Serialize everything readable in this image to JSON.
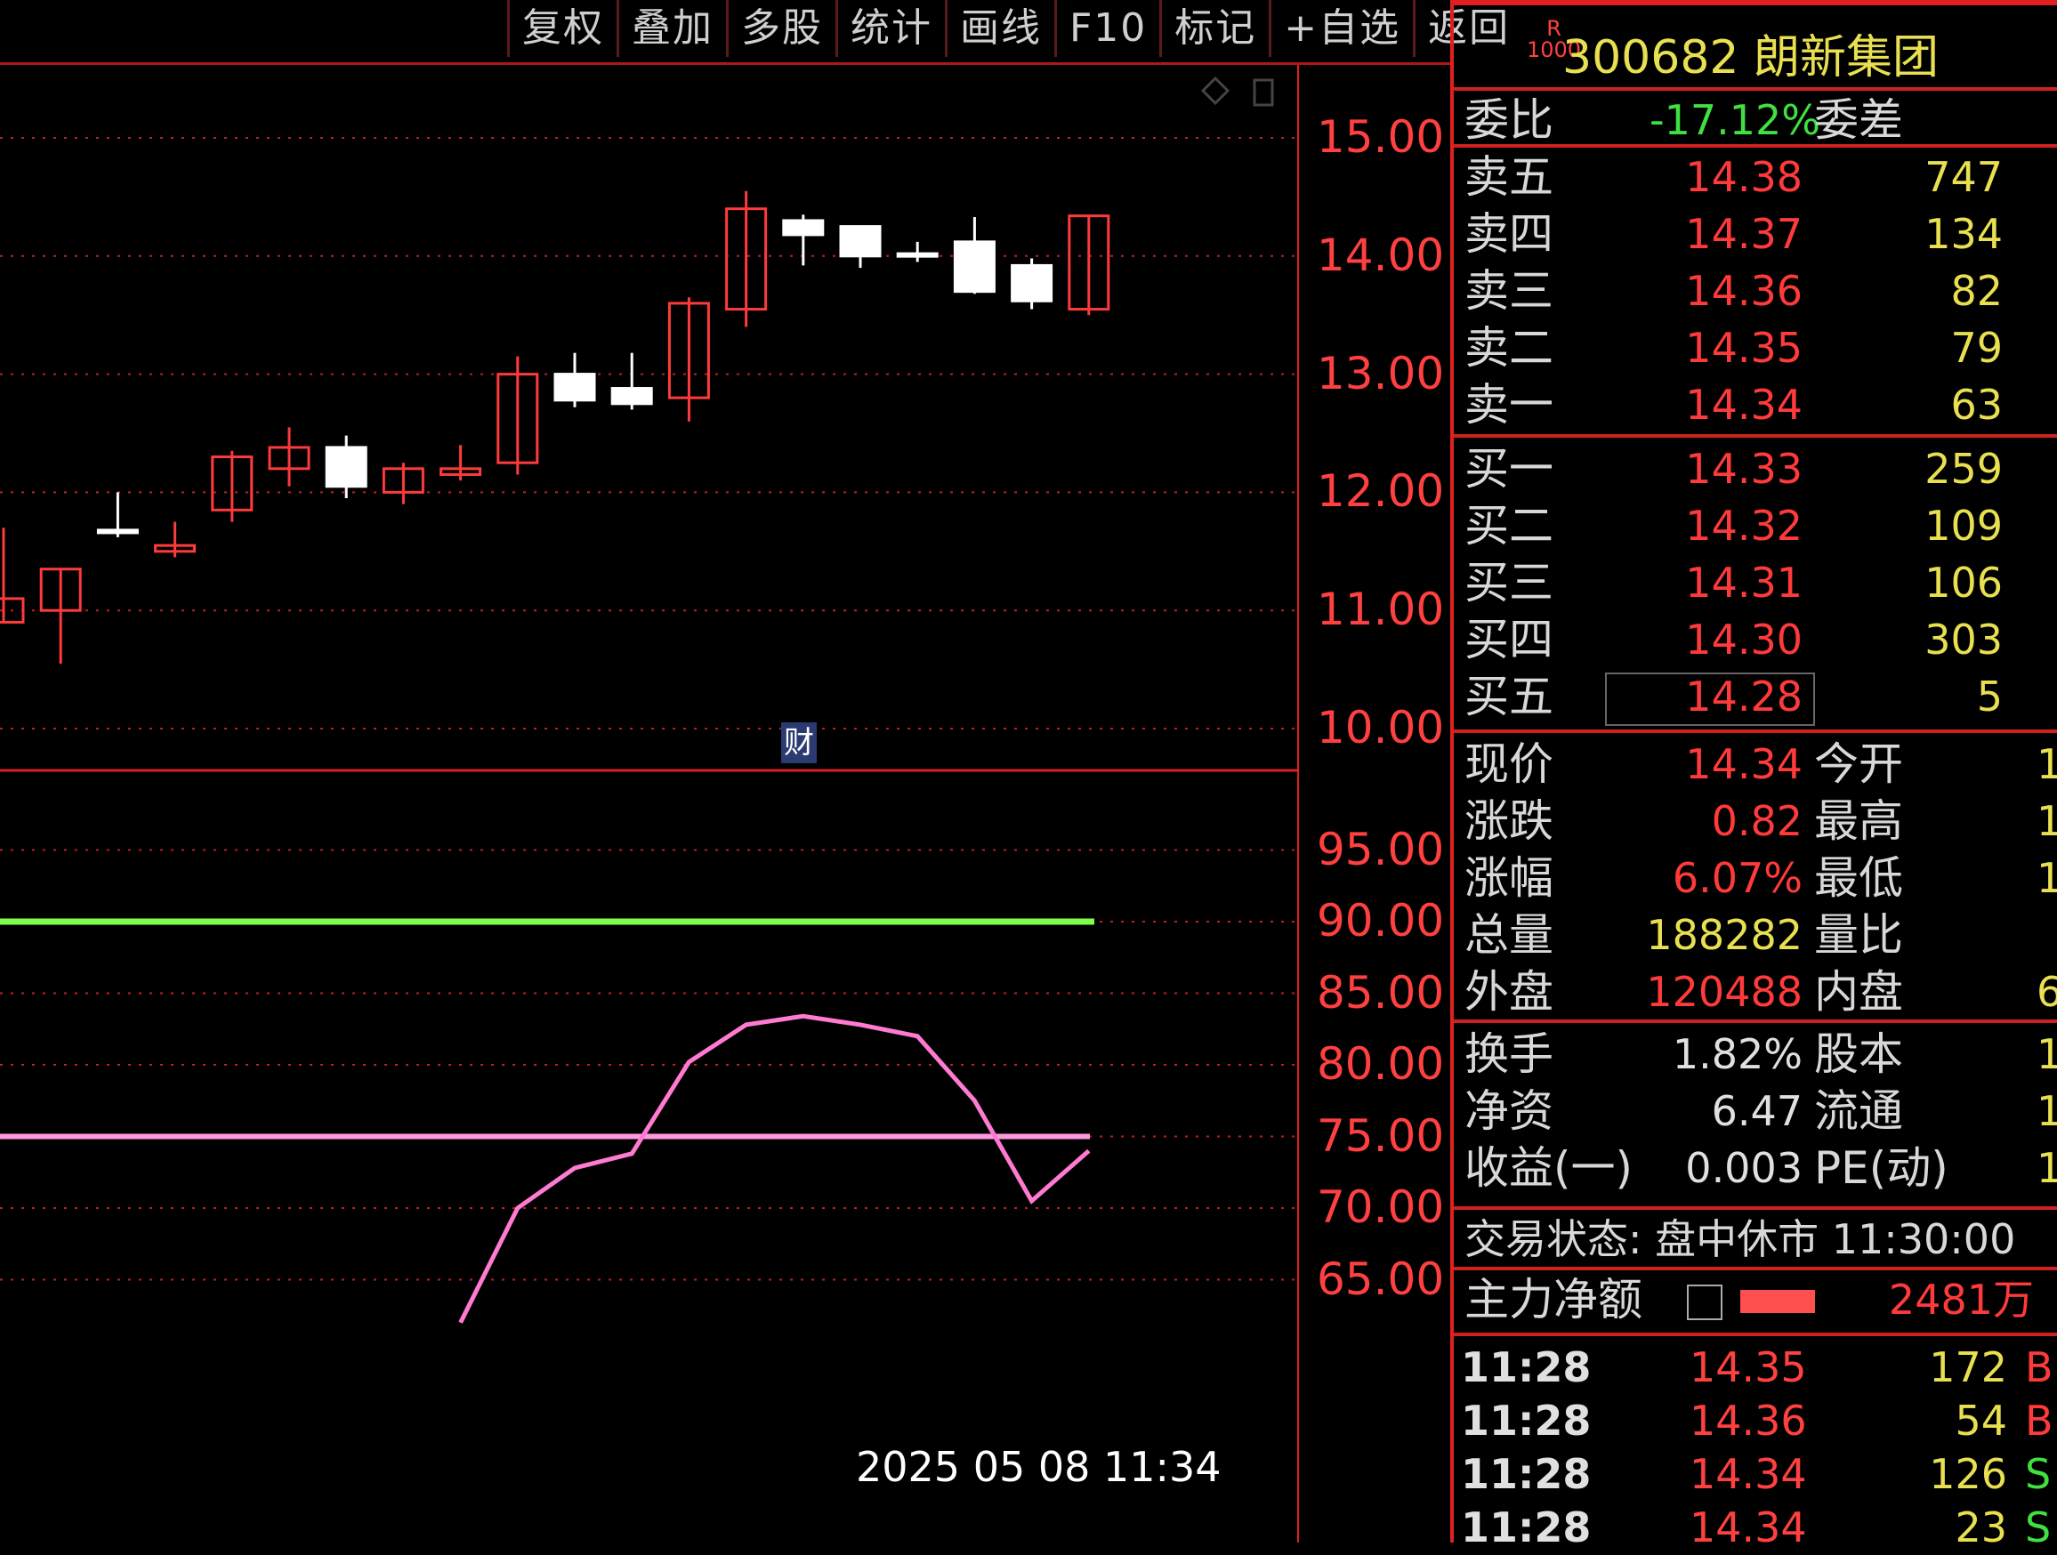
{
  "toolbar": {
    "buttons": [
      "复权",
      "叠加",
      "多股",
      "统计",
      "画线",
      "F10",
      "标记",
      "+自选",
      "返回"
    ]
  },
  "stock": {
    "r_badge": "R",
    "r_badge_num": "1000",
    "code_name": "300682 朗新集团"
  },
  "order_book": {
    "weibi_label": "委比",
    "weibi_value": "-17.12%",
    "weicha_label": "委差",
    "asks": [
      {
        "label": "卖五",
        "price": "14.38",
        "vol": "747"
      },
      {
        "label": "卖四",
        "price": "14.37",
        "vol": "134"
      },
      {
        "label": "卖三",
        "price": "14.36",
        "vol": "82"
      },
      {
        "label": "卖二",
        "price": "14.35",
        "vol": "79"
      },
      {
        "label": "卖一",
        "price": "14.34",
        "vol": "63"
      }
    ],
    "bids": [
      {
        "label": "买一",
        "price": "14.33",
        "vol": "259"
      },
      {
        "label": "买二",
        "price": "14.32",
        "vol": "109"
      },
      {
        "label": "买三",
        "price": "14.31",
        "vol": "106"
      },
      {
        "label": "买四",
        "price": "14.30",
        "vol": "303"
      },
      {
        "label": "买五",
        "price": "14.28",
        "vol": "5"
      }
    ]
  },
  "quote": [
    {
      "label": "现价",
      "value": "14.34",
      "label2": "今开",
      "value2": "1"
    },
    {
      "label": "涨跌",
      "value": "0.82",
      "label2": "最高",
      "value2": "1"
    },
    {
      "label": "涨幅",
      "value": "6.07%",
      "label2": "最低",
      "value2": "1"
    },
    {
      "label": "总量",
      "value": "188282",
      "label2": "量比",
      "value2": ""
    },
    {
      "label": "外盘",
      "value": "120488",
      "label2": "内盘",
      "value2": "6"
    }
  ],
  "fundamentals": [
    {
      "label": "换手",
      "value": "1.82%",
      "label2": "股本",
      "value2": "10"
    },
    {
      "label": "净资",
      "value": "6.47",
      "label2": "流通",
      "value2": "10"
    },
    {
      "label": "收益(一)",
      "value": "0.003",
      "label2": "PE(动)",
      "value2": "11"
    }
  ],
  "status": {
    "text": "交易状态: 盘中休市 11:30:00"
  },
  "main_flow": {
    "label": "主力净额",
    "value": "2481万"
  },
  "ticks": [
    {
      "time": "11:28",
      "price": "14.35",
      "vol": "172",
      "dir": "B"
    },
    {
      "time": "11:28",
      "price": "14.36",
      "vol": "54",
      "dir": "B"
    },
    {
      "time": "11:28",
      "price": "14.34",
      "vol": "126",
      "dir": "S"
    },
    {
      "time": "11:28",
      "price": "14.34",
      "vol": "23",
      "dir": "S"
    }
  ],
  "timestamp": "2025 05 08 11:34",
  "cai_badge": "财",
  "colors": {
    "up": "#ff3a3a",
    "down": "#ffffff",
    "grid": "#c02020",
    "ma_green": "#7fff4a",
    "kdj_pink": "#ff7ad0"
  },
  "chart_data": [
    {
      "type": "candlestick",
      "y_ticks": [
        "15.00",
        "14.00",
        "13.00",
        "12.00",
        "11.00",
        "10.00"
      ],
      "ylim": [
        10.0,
        15.0
      ],
      "candles": [
        {
          "o": 10.9,
          "c": 11.1,
          "h": 11.7,
          "l": 10.9
        },
        {
          "o": 11.0,
          "c": 11.35,
          "h": 11.35,
          "l": 10.55
        },
        {
          "o": 11.68,
          "c": 11.66,
          "h": 12.0,
          "l": 11.62
        },
        {
          "o": 11.5,
          "c": 11.55,
          "h": 11.75,
          "l": 11.45
        },
        {
          "o": 11.85,
          "c": 12.3,
          "h": 12.35,
          "l": 11.75
        },
        {
          "o": 12.2,
          "c": 12.38,
          "h": 12.55,
          "l": 12.05
        },
        {
          "o": 12.38,
          "c": 12.05,
          "h": 12.48,
          "l": 11.95
        },
        {
          "o": 12.0,
          "c": 12.2,
          "h": 12.25,
          "l": 11.9
        },
        {
          "o": 12.15,
          "c": 12.2,
          "h": 12.4,
          "l": 12.1
        },
        {
          "o": 12.25,
          "c": 13.0,
          "h": 13.15,
          "l": 12.15
        },
        {
          "o": 13.0,
          "c": 12.78,
          "h": 13.18,
          "l": 12.72
        },
        {
          "o": 12.88,
          "c": 12.75,
          "h": 13.18,
          "l": 12.7
        },
        {
          "o": 12.8,
          "c": 13.6,
          "h": 13.65,
          "l": 12.6
        },
        {
          "o": 13.55,
          "c": 14.4,
          "h": 14.55,
          "l": 13.4
        },
        {
          "o": 14.3,
          "c": 14.18,
          "h": 14.35,
          "l": 13.92
        },
        {
          "o": 14.25,
          "c": 14.0,
          "h": 14.25,
          "l": 13.9
        },
        {
          "o": 14.02,
          "c": 14.0,
          "h": 14.12,
          "l": 13.95
        },
        {
          "o": 14.12,
          "c": 13.7,
          "h": 14.33,
          "l": 13.68
        },
        {
          "o": 13.92,
          "c": 13.62,
          "h": 13.98,
          "l": 13.55
        },
        {
          "o": 13.55,
          "c": 14.34,
          "h": 14.34,
          "l": 13.5
        }
      ]
    },
    {
      "type": "line",
      "y_ticks": [
        "95.00",
        "90.00",
        "85.00",
        "80.00",
        "75.00",
        "70.00",
        "65.00"
      ],
      "ylim": [
        62.0,
        98.0
      ],
      "ma_green_level": 90.0,
      "ma_pink_level": 75.0,
      "indicator": [
        [
          8.0,
          62.0
        ],
        [
          9.0,
          70.0
        ],
        [
          10.0,
          72.8
        ],
        [
          11.0,
          73.8
        ],
        [
          12.0,
          80.2
        ],
        [
          13.0,
          82.8
        ],
        [
          14.0,
          83.4
        ],
        [
          15.0,
          82.8
        ],
        [
          16.0,
          82.0
        ],
        [
          17.0,
          77.5
        ],
        [
          18.0,
          70.5
        ],
        [
          19.0,
          74.0
        ]
      ]
    }
  ]
}
